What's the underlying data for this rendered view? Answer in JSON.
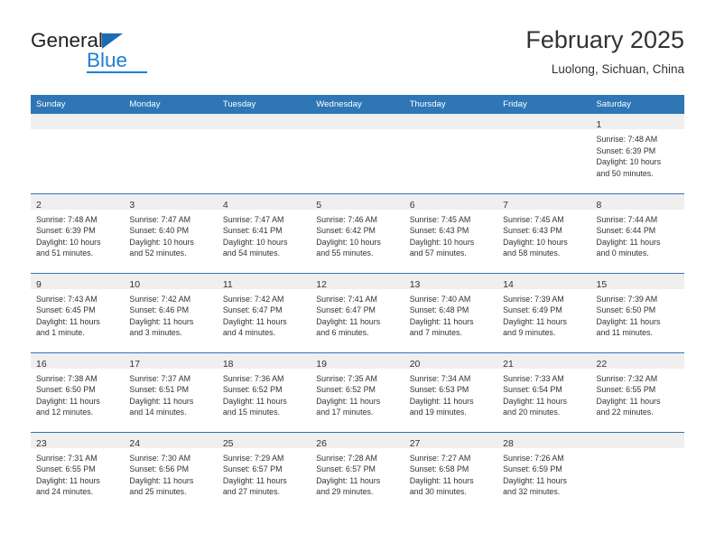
{
  "brand": {
    "name_top": "General",
    "name_bottom": "Blue",
    "triangle_color": "#1c6cb3",
    "blue_color": "#1c7fd4"
  },
  "header": {
    "title": "February 2025",
    "subtitle": "Luolong, Sichuan, China"
  },
  "theme": {
    "header_bg": "#2e76b6",
    "daynum_bg": "#efefef",
    "text": "#333333"
  },
  "weekdays": [
    "Sunday",
    "Monday",
    "Tuesday",
    "Wednesday",
    "Thursday",
    "Friday",
    "Saturday"
  ],
  "labels": {
    "sunrise_prefix": "Sunrise:",
    "sunset_prefix": "Sunset:",
    "daylight_prefix": "Daylight:"
  },
  "weeks": [
    [
      {
        "day": "",
        "lines": []
      },
      {
        "day": "",
        "lines": []
      },
      {
        "day": "",
        "lines": []
      },
      {
        "day": "",
        "lines": []
      },
      {
        "day": "",
        "lines": []
      },
      {
        "day": "",
        "lines": []
      },
      {
        "day": "1",
        "lines": [
          "Sunrise: 7:48 AM",
          "Sunset: 6:39 PM",
          "Daylight: 10 hours",
          "and 50 minutes."
        ]
      }
    ],
    [
      {
        "day": "2",
        "lines": [
          "Sunrise: 7:48 AM",
          "Sunset: 6:39 PM",
          "Daylight: 10 hours",
          "and 51 minutes."
        ]
      },
      {
        "day": "3",
        "lines": [
          "Sunrise: 7:47 AM",
          "Sunset: 6:40 PM",
          "Daylight: 10 hours",
          "and 52 minutes."
        ]
      },
      {
        "day": "4",
        "lines": [
          "Sunrise: 7:47 AM",
          "Sunset: 6:41 PM",
          "Daylight: 10 hours",
          "and 54 minutes."
        ]
      },
      {
        "day": "5",
        "lines": [
          "Sunrise: 7:46 AM",
          "Sunset: 6:42 PM",
          "Daylight: 10 hours",
          "and 55 minutes."
        ]
      },
      {
        "day": "6",
        "lines": [
          "Sunrise: 7:45 AM",
          "Sunset: 6:43 PM",
          "Daylight: 10 hours",
          "and 57 minutes."
        ]
      },
      {
        "day": "7",
        "lines": [
          "Sunrise: 7:45 AM",
          "Sunset: 6:43 PM",
          "Daylight: 10 hours",
          "and 58 minutes."
        ]
      },
      {
        "day": "8",
        "lines": [
          "Sunrise: 7:44 AM",
          "Sunset: 6:44 PM",
          "Daylight: 11 hours",
          "and 0 minutes."
        ]
      }
    ],
    [
      {
        "day": "9",
        "lines": [
          "Sunrise: 7:43 AM",
          "Sunset: 6:45 PM",
          "Daylight: 11 hours",
          "and 1 minute."
        ]
      },
      {
        "day": "10",
        "lines": [
          "Sunrise: 7:42 AM",
          "Sunset: 6:46 PM",
          "Daylight: 11 hours",
          "and 3 minutes."
        ]
      },
      {
        "day": "11",
        "lines": [
          "Sunrise: 7:42 AM",
          "Sunset: 6:47 PM",
          "Daylight: 11 hours",
          "and 4 minutes."
        ]
      },
      {
        "day": "12",
        "lines": [
          "Sunrise: 7:41 AM",
          "Sunset: 6:47 PM",
          "Daylight: 11 hours",
          "and 6 minutes."
        ]
      },
      {
        "day": "13",
        "lines": [
          "Sunrise: 7:40 AM",
          "Sunset: 6:48 PM",
          "Daylight: 11 hours",
          "and 7 minutes."
        ]
      },
      {
        "day": "14",
        "lines": [
          "Sunrise: 7:39 AM",
          "Sunset: 6:49 PM",
          "Daylight: 11 hours",
          "and 9 minutes."
        ]
      },
      {
        "day": "15",
        "lines": [
          "Sunrise: 7:39 AM",
          "Sunset: 6:50 PM",
          "Daylight: 11 hours",
          "and 11 minutes."
        ]
      }
    ],
    [
      {
        "day": "16",
        "lines": [
          "Sunrise: 7:38 AM",
          "Sunset: 6:50 PM",
          "Daylight: 11 hours",
          "and 12 minutes."
        ]
      },
      {
        "day": "17",
        "lines": [
          "Sunrise: 7:37 AM",
          "Sunset: 6:51 PM",
          "Daylight: 11 hours",
          "and 14 minutes."
        ]
      },
      {
        "day": "18",
        "lines": [
          "Sunrise: 7:36 AM",
          "Sunset: 6:52 PM",
          "Daylight: 11 hours",
          "and 15 minutes."
        ]
      },
      {
        "day": "19",
        "lines": [
          "Sunrise: 7:35 AM",
          "Sunset: 6:52 PM",
          "Daylight: 11 hours",
          "and 17 minutes."
        ]
      },
      {
        "day": "20",
        "lines": [
          "Sunrise: 7:34 AM",
          "Sunset: 6:53 PM",
          "Daylight: 11 hours",
          "and 19 minutes."
        ]
      },
      {
        "day": "21",
        "lines": [
          "Sunrise: 7:33 AM",
          "Sunset: 6:54 PM",
          "Daylight: 11 hours",
          "and 20 minutes."
        ]
      },
      {
        "day": "22",
        "lines": [
          "Sunrise: 7:32 AM",
          "Sunset: 6:55 PM",
          "Daylight: 11 hours",
          "and 22 minutes."
        ]
      }
    ],
    [
      {
        "day": "23",
        "lines": [
          "Sunrise: 7:31 AM",
          "Sunset: 6:55 PM",
          "Daylight: 11 hours",
          "and 24 minutes."
        ]
      },
      {
        "day": "24",
        "lines": [
          "Sunrise: 7:30 AM",
          "Sunset: 6:56 PM",
          "Daylight: 11 hours",
          "and 25 minutes."
        ]
      },
      {
        "day": "25",
        "lines": [
          "Sunrise: 7:29 AM",
          "Sunset: 6:57 PM",
          "Daylight: 11 hours",
          "and 27 minutes."
        ]
      },
      {
        "day": "26",
        "lines": [
          "Sunrise: 7:28 AM",
          "Sunset: 6:57 PM",
          "Daylight: 11 hours",
          "and 29 minutes."
        ]
      },
      {
        "day": "27",
        "lines": [
          "Sunrise: 7:27 AM",
          "Sunset: 6:58 PM",
          "Daylight: 11 hours",
          "and 30 minutes."
        ]
      },
      {
        "day": "28",
        "lines": [
          "Sunrise: 7:26 AM",
          "Sunset: 6:59 PM",
          "Daylight: 11 hours",
          "and 32 minutes."
        ]
      },
      {
        "day": "",
        "lines": []
      }
    ]
  ]
}
